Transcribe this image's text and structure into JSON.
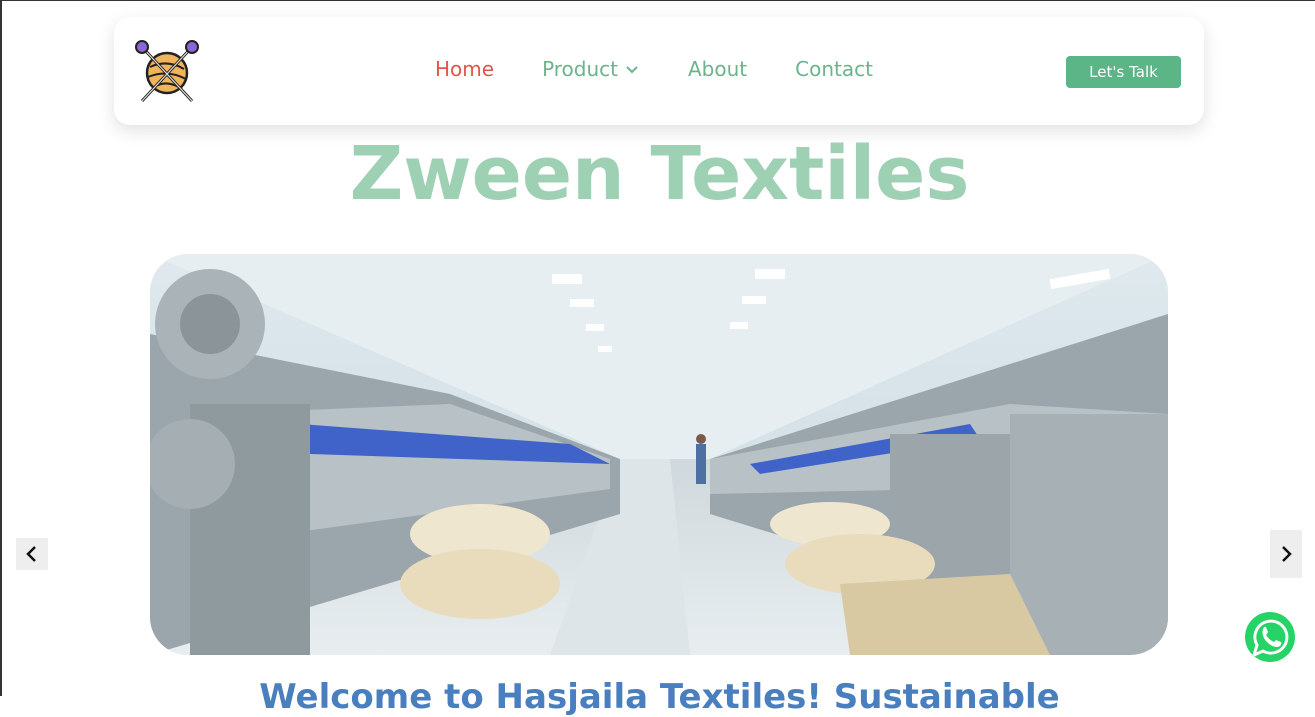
{
  "nav": {
    "items": [
      {
        "label": "Home",
        "active": true
      },
      {
        "label": "Product",
        "has_dropdown": true
      },
      {
        "label": "About"
      },
      {
        "label": "Contact"
      }
    ],
    "cta_label": "Let's Talk"
  },
  "hero": {
    "title": "Zween Textiles",
    "slide_image": "textile-factory-looms"
  },
  "welcome_text": "Welcome to Hasjaila Textiles! Sustainable",
  "icons": {
    "logo": "yarn-ball-knitting-needles-icon",
    "prev": "chevron-left-icon",
    "next": "chevron-right-icon",
    "whatsapp": "whatsapp-icon"
  },
  "colors": {
    "accent": "#5cb587",
    "nav_text": "#6bb48c",
    "nav_active": "#e0564a",
    "title": "#9ed1b4",
    "welcome": "#4a7fbf"
  }
}
